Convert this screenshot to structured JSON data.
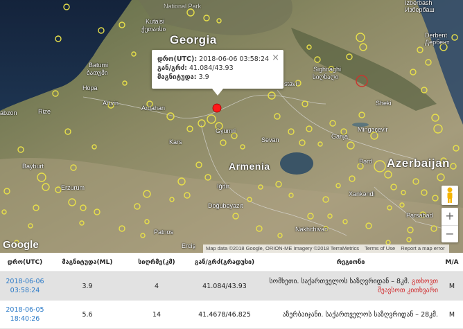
{
  "map": {
    "places": {
      "georgia": "Georgia",
      "armenia": "Armenia",
      "azerbaijan": "Azerbaijan",
      "kutaisi": "Kutaisi",
      "kutaisi_ka": "ქუთაისი",
      "batumi": "Batumi",
      "batumi_ka": "ბათუმი",
      "hopa": "Hopa",
      "artvin": "Artvin",
      "rize": "Rize",
      "trabzon": "abzon",
      "ardahan": "Ardahan",
      "kars": "Kars",
      "gyumri": "Gyumri",
      "sevan": "Sevan",
      "igdir": "Iğdır",
      "dogubayazit": "Doğubeyazıt",
      "bayburt": "Bayburt",
      "erzurum": "Erzurum",
      "patnos": "Patnos",
      "ercis": "Erciş",
      "nakhchivan": "Nakhchivan",
      "parsabad": "Parsabad",
      "sighnaghi": "Sighnaghi",
      "sighnaghi_ka": "სიღნაღი",
      "rustavi": "stavi",
      "sheki": "Sheki",
      "mingecevir": "Mingəçevir",
      "ganja": "Ganja",
      "barda": "Bərd",
      "xankendi": "Xankəndi",
      "derbent": "Derbent",
      "derbent_ru": "Дербент",
      "izberbash": "Izberbash",
      "izberbash_ru": "Избербаш",
      "national_park": "National Park"
    },
    "popup": {
      "time_label": "დრო(UTC):",
      "time_value": "2018-06-06 03:58:24",
      "coord_label": "გან/გრძ:",
      "coord_value": "41.084/43.93",
      "mag_label": "მაგნიტუდა:",
      "mag_value": "3.9",
      "close": "×"
    },
    "zoom_in": "+",
    "zoom_out": "−",
    "google": "Google",
    "attribution": {
      "data": "Map data ©2018 Google, ORION-ME Imagery ©2018 TerraMetrics",
      "terms": "Terms of Use",
      "report": "Report a map error"
    },
    "colors": {
      "marker": "#e8e04a",
      "selected": "#ff1a1a",
      "popup_bg": "#ffffff"
    }
  },
  "table": {
    "headers": [
      "დრო(UTC)",
      "მაგნიტუდა(ML)",
      "სიღრმე(კმ)",
      "გან/გრძ(გრადუსი)",
      "რეგიონი",
      "M/A"
    ],
    "rows": [
      {
        "date": "2018-06-06",
        "time": "03:58:24",
        "magnitude": "3.9",
        "depth": "4",
        "coords": "41.084/43.93",
        "region": "სომხეთი. საქართველოს საზღვრიდან – 8კმ.",
        "region_link_1": "გთხოვთ",
        "region_link_2": "შეავსოთ კითხვარი",
        "ma": "M"
      },
      {
        "date": "2018-06-05",
        "time": "18:40:26",
        "magnitude": "5.6",
        "depth": "14",
        "coords": "41.4678/46.825",
        "region": "აზერბაიჯანი. საქართველოს საზღვრიდან – 28კმ.",
        "ma": "M"
      }
    ]
  }
}
